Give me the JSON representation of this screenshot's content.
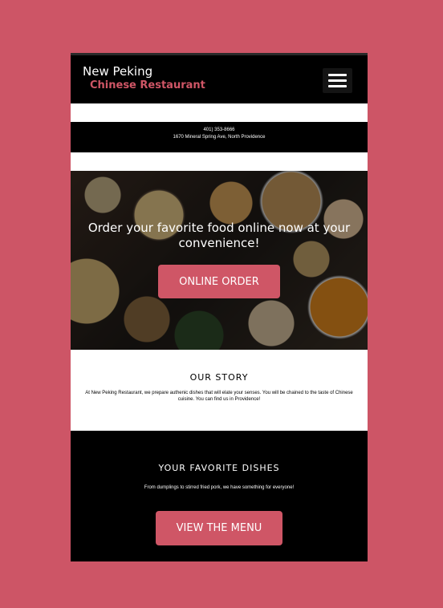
{
  "header": {
    "brand_line1": "New Peking",
    "brand_line2": "Chinese Restaurant",
    "menu_icon": "hamburger-menu-icon"
  },
  "contact": {
    "phone": "401) 353-8666",
    "address": "1670 Mineral Spring Ave, North Providence"
  },
  "hero": {
    "headline": "Order your favorite food online now at your convenience!",
    "cta_label": "ONLINE ORDER"
  },
  "story": {
    "title": "OUR STORY",
    "body": "At New Peking Restaurant, we prepare authenic dishes that will elate your senses. You will be chained to the taste of Chinese cuisine. You can find us in Providence!"
  },
  "dishes": {
    "title": "YOUR FAVORITE DISHES",
    "subtitle": "From dumplings to stirred fried pork, we have something for everyone!",
    "cta_label": "VIEW THE MENU"
  },
  "colors": {
    "accent": "#cf5666",
    "background": "#cd5566",
    "header": "#000000"
  }
}
